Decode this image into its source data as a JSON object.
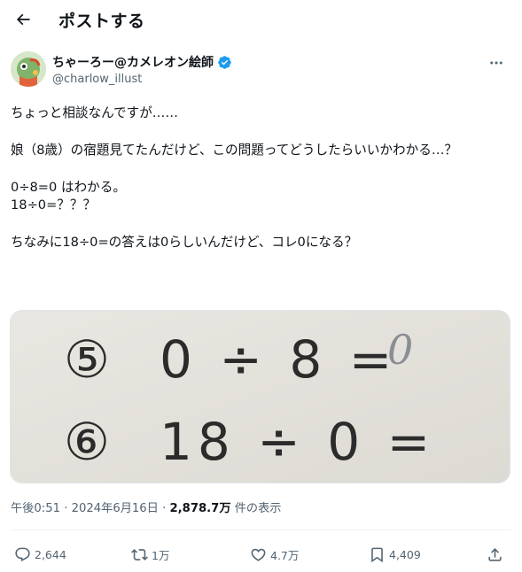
{
  "header": {
    "title": "ポストする",
    "back_icon": "arrow-left-icon"
  },
  "author": {
    "display_name": "ちゃーろー@カメレオン絵師",
    "handle": "@charlow_illust",
    "verified": true,
    "verified_color": "#1d9bf0",
    "avatar_icon": "avatar-illustration"
  },
  "tweet": {
    "line1": "ちょっと相談なんですが……",
    "line2": "娘（8歳）の宿題見てたんだけど、この問題ってどうしたらいいかわかる…？",
    "line3": "0÷8=0 はわかる。\n18÷0=？？？",
    "line4": "ちなみに18÷0=の答えは0らしいんだけど、コレ0になる？"
  },
  "media": {
    "row1_number": "⑤",
    "row1_expression": "0 ÷ 8 =",
    "row1_answer": "0",
    "row2_number": "⑥",
    "row2_expression": "18 ÷ 0 ="
  },
  "meta": {
    "time": "午後0:51",
    "separator1": " · ",
    "date": "2024年6月16日",
    "separator2": " · ",
    "views_count": "2,878.7万",
    "views_label": " 件の表示"
  },
  "actions": {
    "replies": "2,644",
    "reposts": "1万",
    "likes": "4.7万",
    "bookmarks": "4,409"
  },
  "colors": {
    "text": "#0f1419",
    "muted": "#536471",
    "accent": "#1d9bf0"
  }
}
